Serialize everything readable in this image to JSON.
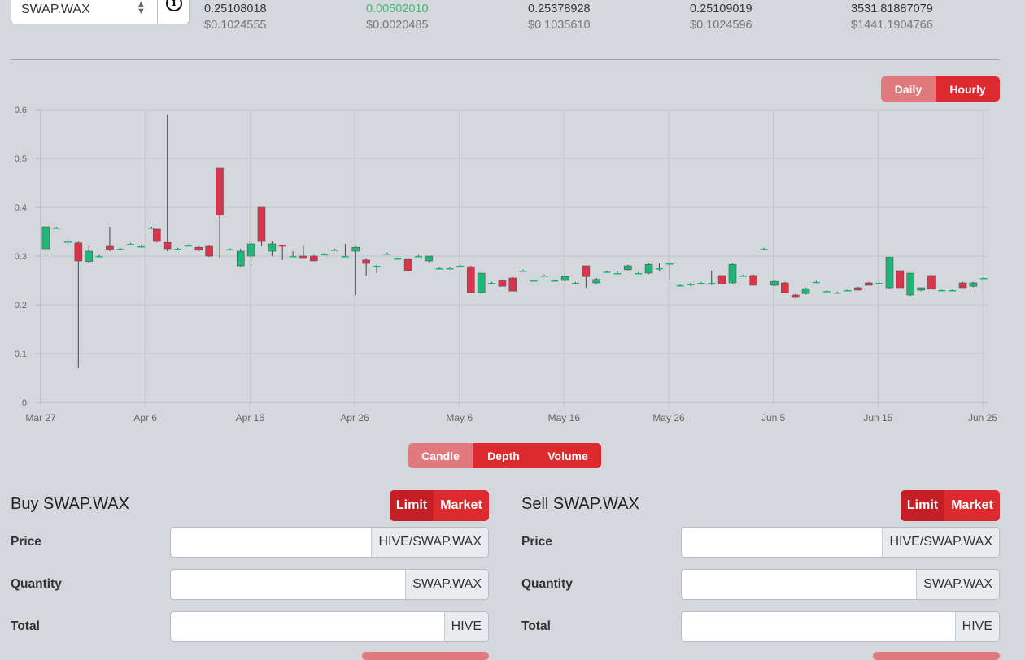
{
  "market": {
    "symbol": "SWAP.WAX"
  },
  "stats": [
    {
      "hive": "0.25108018",
      "usd": "$0.1024555",
      "positive": false
    },
    {
      "hive": "0.00502010",
      "usd": "$0.0020485",
      "positive": true
    },
    {
      "hive": "0.25378928",
      "usd": "$0.1035610",
      "positive": false
    },
    {
      "hive": "0.25109019",
      "usd": "$0.1024596",
      "positive": false
    },
    {
      "hive": "3531.81887079",
      "usd": "$1441.1904766",
      "positive": false
    }
  ],
  "interval_toggle": {
    "daily": "Daily",
    "hourly": "Hourly",
    "selected": "Hourly"
  },
  "chart_tabs": {
    "candle": "Candle",
    "depth": "Depth",
    "volume": "Volume"
  },
  "chart_data": {
    "type": "candlestick",
    "y_ticks": [
      "0",
      "0.1",
      "0.2",
      "0.3",
      "0.4",
      "0.5",
      "0.6"
    ],
    "ylim": [
      0,
      0.6
    ],
    "x_ticks": [
      "Mar 27",
      "Apr 6",
      "Apr 16",
      "Apr 26",
      "May 6",
      "May 16",
      "May 26",
      "Jun 5",
      "Jun 15",
      "Jun 25"
    ],
    "xlim": [
      0,
      90
    ],
    "grid": true,
    "colors": {
      "up": "#1cb877",
      "down": "#d9344c"
    },
    "candles": [
      {
        "x": 0.5,
        "o": 0.315,
        "h": 0.36,
        "l": 0.3,
        "c": 0.36
      },
      {
        "x": 1.5,
        "o": 0.358,
        "h": 0.36,
        "l": 0.356,
        "c": 0.358
      },
      {
        "x": 2.6,
        "o": 0.33,
        "h": 0.332,
        "l": 0.328,
        "c": 0.33
      },
      {
        "x": 3.6,
        "o": 0.327,
        "h": 0.33,
        "l": 0.07,
        "c": 0.29
      },
      {
        "x": 4.6,
        "o": 0.289,
        "h": 0.32,
        "l": 0.285,
        "c": 0.31
      },
      {
        "x": 5.6,
        "o": 0.3,
        "h": 0.302,
        "l": 0.298,
        "c": 0.3
      },
      {
        "x": 6.6,
        "o": 0.32,
        "h": 0.36,
        "l": 0.31,
        "c": 0.314
      },
      {
        "x": 7.6,
        "o": 0.315,
        "h": 0.317,
        "l": 0.313,
        "c": 0.315
      },
      {
        "x": 8.6,
        "o": 0.325,
        "h": 0.327,
        "l": 0.323,
        "c": 0.325
      },
      {
        "x": 9.6,
        "o": 0.32,
        "h": 0.322,
        "l": 0.318,
        "c": 0.32
      },
      {
        "x": 10.6,
        "o": 0.358,
        "h": 0.36,
        "l": 0.356,
        "c": 0.358
      },
      {
        "x": 11.1,
        "o": 0.355,
        "h": 0.356,
        "l": 0.328,
        "c": 0.33
      },
      {
        "x": 12.1,
        "o": 0.328,
        "h": 0.59,
        "l": 0.31,
        "c": 0.315
      },
      {
        "x": 13.1,
        "o": 0.315,
        "h": 0.317,
        "l": 0.313,
        "c": 0.315
      },
      {
        "x": 14.1,
        "o": 0.322,
        "h": 0.324,
        "l": 0.32,
        "c": 0.322
      },
      {
        "x": 15.1,
        "o": 0.318,
        "h": 0.32,
        "l": 0.31,
        "c": 0.312
      },
      {
        "x": 16.1,
        "o": 0.32,
        "h": 0.322,
        "l": 0.298,
        "c": 0.3
      },
      {
        "x": 17.1,
        "o": 0.48,
        "h": 0.48,
        "l": 0.295,
        "c": 0.384
      },
      {
        "x": 18.1,
        "o": 0.314,
        "h": 0.316,
        "l": 0.312,
        "c": 0.314
      },
      {
        "x": 19.1,
        "o": 0.28,
        "h": 0.315,
        "l": 0.278,
        "c": 0.31
      },
      {
        "x": 20.1,
        "o": 0.3,
        "h": 0.33,
        "l": 0.28,
        "c": 0.325
      },
      {
        "x": 21.1,
        "o": 0.4,
        "h": 0.4,
        "l": 0.32,
        "c": 0.33
      },
      {
        "x": 22.1,
        "o": 0.31,
        "h": 0.33,
        "l": 0.3,
        "c": 0.325
      },
      {
        "x": 23.1,
        "o": 0.322,
        "h": 0.322,
        "l": 0.292,
        "c": 0.32
      },
      {
        "x": 24.1,
        "o": 0.3,
        "h": 0.31,
        "l": 0.298,
        "c": 0.3
      },
      {
        "x": 25.1,
        "o": 0.3,
        "h": 0.32,
        "l": 0.295,
        "c": 0.295
      },
      {
        "x": 26.1,
        "o": 0.3,
        "h": 0.302,
        "l": 0.29,
        "c": 0.29
      },
      {
        "x": 27.1,
        "o": 0.304,
        "h": 0.306,
        "l": 0.302,
        "c": 0.304
      },
      {
        "x": 28.1,
        "o": 0.313,
        "h": 0.315,
        "l": 0.311,
        "c": 0.313
      },
      {
        "x": 29.1,
        "o": 0.3,
        "h": 0.325,
        "l": 0.298,
        "c": 0.3
      },
      {
        "x": 30.1,
        "o": 0.31,
        "h": 0.32,
        "l": 0.22,
        "c": 0.318
      },
      {
        "x": 31.1,
        "o": 0.292,
        "h": 0.294,
        "l": 0.26,
        "c": 0.285
      },
      {
        "x": 32.1,
        "o": 0.28,
        "h": 0.282,
        "l": 0.265,
        "c": 0.28
      },
      {
        "x": 33.1,
        "o": 0.305,
        "h": 0.307,
        "l": 0.303,
        "c": 0.305
      },
      {
        "x": 34.1,
        "o": 0.295,
        "h": 0.297,
        "l": 0.293,
        "c": 0.295
      },
      {
        "x": 35.1,
        "o": 0.293,
        "h": 0.295,
        "l": 0.27,
        "c": 0.27
      },
      {
        "x": 36.1,
        "o": 0.3,
        "h": 0.302,
        "l": 0.298,
        "c": 0.3
      },
      {
        "x": 37.1,
        "o": 0.29,
        "h": 0.3,
        "l": 0.288,
        "c": 0.3
      },
      {
        "x": 38.1,
        "o": 0.275,
        "h": 0.277,
        "l": 0.273,
        "c": 0.275
      },
      {
        "x": 39.1,
        "o": 0.275,
        "h": 0.277,
        "l": 0.273,
        "c": 0.275
      },
      {
        "x": 40.1,
        "o": 0.28,
        "h": 0.282,
        "l": 0.278,
        "c": 0.28
      },
      {
        "x": 41.1,
        "o": 0.278,
        "h": 0.28,
        "l": 0.225,
        "c": 0.225
      },
      {
        "x": 42.1,
        "o": 0.225,
        "h": 0.265,
        "l": 0.223,
        "c": 0.265
      },
      {
        "x": 43.1,
        "o": 0.245,
        "h": 0.247,
        "l": 0.243,
        "c": 0.245
      },
      {
        "x": 44.1,
        "o": 0.25,
        "h": 0.252,
        "l": 0.238,
        "c": 0.238
      },
      {
        "x": 45.1,
        "o": 0.255,
        "h": 0.257,
        "l": 0.228,
        "c": 0.228
      },
      {
        "x": 46.1,
        "o": 0.27,
        "h": 0.272,
        "l": 0.268,
        "c": 0.27
      },
      {
        "x": 47.1,
        "o": 0.25,
        "h": 0.252,
        "l": 0.248,
        "c": 0.25
      },
      {
        "x": 48.1,
        "o": 0.26,
        "h": 0.262,
        "l": 0.258,
        "c": 0.26
      },
      {
        "x": 49.1,
        "o": 0.25,
        "h": 0.252,
        "l": 0.248,
        "c": 0.25
      },
      {
        "x": 50.1,
        "o": 0.25,
        "h": 0.26,
        "l": 0.248,
        "c": 0.258
      },
      {
        "x": 51.1,
        "o": 0.245,
        "h": 0.247,
        "l": 0.243,
        "c": 0.245
      },
      {
        "x": 52.1,
        "o": 0.28,
        "h": 0.28,
        "l": 0.235,
        "c": 0.258
      },
      {
        "x": 53.1,
        "o": 0.245,
        "h": 0.255,
        "l": 0.242,
        "c": 0.252
      },
      {
        "x": 54.1,
        "o": 0.268,
        "h": 0.27,
        "l": 0.266,
        "c": 0.268
      },
      {
        "x": 55.1,
        "o": 0.265,
        "h": 0.27,
        "l": 0.263,
        "c": 0.265
      },
      {
        "x": 56.1,
        "o": 0.272,
        "h": 0.282,
        "l": 0.27,
        "c": 0.28
      },
      {
        "x": 57.1,
        "o": 0.265,
        "h": 0.267,
        "l": 0.263,
        "c": 0.265
      },
      {
        "x": 58.1,
        "o": 0.265,
        "h": 0.285,
        "l": 0.263,
        "c": 0.283
      },
      {
        "x": 59.1,
        "o": 0.275,
        "h": 0.285,
        "l": 0.27,
        "c": 0.275
      },
      {
        "x": 60.1,
        "o": 0.285,
        "h": 0.285,
        "l": 0.25,
        "c": 0.285
      },
      {
        "x": 61.1,
        "o": 0.24,
        "h": 0.242,
        "l": 0.238,
        "c": 0.24
      },
      {
        "x": 62.1,
        "o": 0.24,
        "h": 0.245,
        "l": 0.238,
        "c": 0.243
      },
      {
        "x": 63.1,
        "o": 0.245,
        "h": 0.247,
        "l": 0.243,
        "c": 0.245
      },
      {
        "x": 64.1,
        "o": 0.245,
        "h": 0.27,
        "l": 0.24,
        "c": 0.245
      },
      {
        "x": 65.1,
        "o": 0.26,
        "h": 0.262,
        "l": 0.242,
        "c": 0.243
      },
      {
        "x": 66.1,
        "o": 0.245,
        "h": 0.285,
        "l": 0.243,
        "c": 0.283
      },
      {
        "x": 67.1,
        "o": 0.26,
        "h": 0.262,
        "l": 0.258,
        "c": 0.26
      },
      {
        "x": 68.1,
        "o": 0.26,
        "h": 0.262,
        "l": 0.24,
        "c": 0.24
      },
      {
        "x": 69.1,
        "o": 0.315,
        "h": 0.317,
        "l": 0.313,
        "c": 0.315
      },
      {
        "x": 70.1,
        "o": 0.24,
        "h": 0.25,
        "l": 0.238,
        "c": 0.248
      },
      {
        "x": 71.1,
        "o": 0.245,
        "h": 0.247,
        "l": 0.225,
        "c": 0.225
      },
      {
        "x": 72.1,
        "o": 0.22,
        "h": 0.222,
        "l": 0.213,
        "c": 0.215
      },
      {
        "x": 73.1,
        "o": 0.223,
        "h": 0.235,
        "l": 0.221,
        "c": 0.233
      },
      {
        "x": 74.1,
        "o": 0.247,
        "h": 0.249,
        "l": 0.245,
        "c": 0.247
      },
      {
        "x": 75.1,
        "o": 0.228,
        "h": 0.23,
        "l": 0.226,
        "c": 0.228
      },
      {
        "x": 76.1,
        "o": 0.225,
        "h": 0.227,
        "l": 0.223,
        "c": 0.225
      },
      {
        "x": 77.1,
        "o": 0.23,
        "h": 0.232,
        "l": 0.228,
        "c": 0.23
      },
      {
        "x": 78.1,
        "o": 0.235,
        "h": 0.237,
        "l": 0.23,
        "c": 0.23
      },
      {
        "x": 79.1,
        "o": 0.245,
        "h": 0.247,
        "l": 0.24,
        "c": 0.24
      },
      {
        "x": 80.1,
        "o": 0.245,
        "h": 0.247,
        "l": 0.243,
        "c": 0.245
      },
      {
        "x": 81.1,
        "o": 0.235,
        "h": 0.298,
        "l": 0.233,
        "c": 0.298
      },
      {
        "x": 82.1,
        "o": 0.27,
        "h": 0.27,
        "l": 0.235,
        "c": 0.235
      },
      {
        "x": 83.1,
        "o": 0.22,
        "h": 0.265,
        "l": 0.218,
        "c": 0.265
      },
      {
        "x": 84.1,
        "o": 0.23,
        "h": 0.235,
        "l": 0.228,
        "c": 0.235
      },
      {
        "x": 85.1,
        "o": 0.26,
        "h": 0.262,
        "l": 0.232,
        "c": 0.232
      },
      {
        "x": 86.1,
        "o": 0.23,
        "h": 0.232,
        "l": 0.228,
        "c": 0.23
      },
      {
        "x": 87.1,
        "o": 0.23,
        "h": 0.232,
        "l": 0.228,
        "c": 0.23
      },
      {
        "x": 88.1,
        "o": 0.245,
        "h": 0.247,
        "l": 0.235,
        "c": 0.235
      },
      {
        "x": 89.1,
        "o": 0.238,
        "h": 0.247,
        "l": 0.236,
        "c": 0.245
      },
      {
        "x": 90.1,
        "o": 0.255,
        "h": 0.256,
        "l": 0.254,
        "c": 0.255
      }
    ]
  },
  "buy": {
    "title": "Buy SWAP.WAX",
    "limit": "Limit",
    "market": "Market",
    "price_label": "Price",
    "price_value": "",
    "price_unit": "HIVE/SWAP.WAX",
    "quantity_label": "Quantity",
    "quantity_value": "",
    "quantity_unit": "SWAP.WAX",
    "total_label": "Total",
    "total_value": "",
    "total_unit": "HIVE"
  },
  "sell": {
    "title": "Sell SWAP.WAX",
    "limit": "Limit",
    "market": "Market",
    "price_label": "Price",
    "price_value": "",
    "price_unit": "HIVE/SWAP.WAX",
    "quantity_label": "Quantity",
    "quantity_value": "",
    "quantity_unit": "SWAP.WAX",
    "total_label": "Total",
    "total_value": "",
    "total_unit": "HIVE"
  }
}
